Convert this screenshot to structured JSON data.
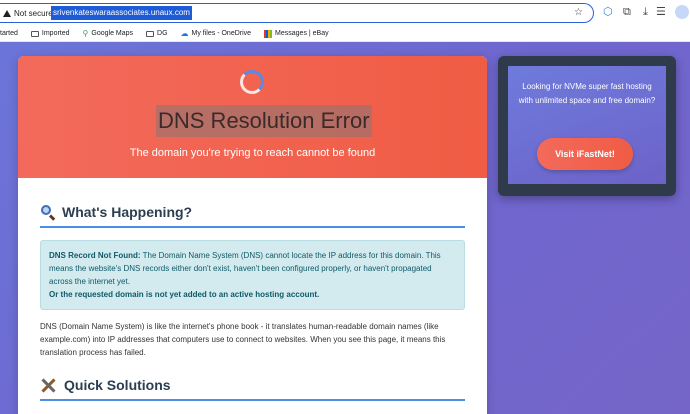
{
  "browser": {
    "not_secure_label": "Not secure",
    "url": "srivenkateswaraassociates.unaux.com",
    "bookmarks": [
      {
        "label": "tarted",
        "icon": "none"
      },
      {
        "label": "Imported",
        "icon": "folder-icon"
      },
      {
        "label": "Google Maps",
        "icon": "maps-pin-icon"
      },
      {
        "label": "DG",
        "icon": "folder-icon"
      },
      {
        "label": "My files - OneDrive",
        "icon": "onedrive-cloud-icon"
      },
      {
        "label": "Messages | eBay",
        "icon": "ebay-icon"
      }
    ]
  },
  "page": {
    "hero_title": "DNS Resolution Error",
    "hero_subtitle": "The domain you're trying to reach cannot be found",
    "section1_title": "What's Happening?",
    "info_box": {
      "lead": "DNS Record Not Found:",
      "body": "The Domain Name System (DNS) cannot locate the IP address for this domain. This means the website's DNS records either don't exist, haven't been configured properly, or haven't propagated across the internet yet.",
      "bold_line": "Or the requested domain is not yet added to an active hosting account."
    },
    "paragraph": "DNS (Domain Name System) is like the internet's phone book - it translates human-readable domain names (like example.com) into IP addresses that computers use to connect to websites. When you see this page, it means this translation process has failed.",
    "section2_title": "Quick Solutions"
  },
  "ad": {
    "text": "Looking for NVMe super fast hosting with unlimited space and free domain?",
    "button_label": "Visit iFastNet!"
  },
  "colors": {
    "hero_red": "#f05c44",
    "accent_blue": "#4a90e2",
    "background_purple": "#6f66cf"
  }
}
